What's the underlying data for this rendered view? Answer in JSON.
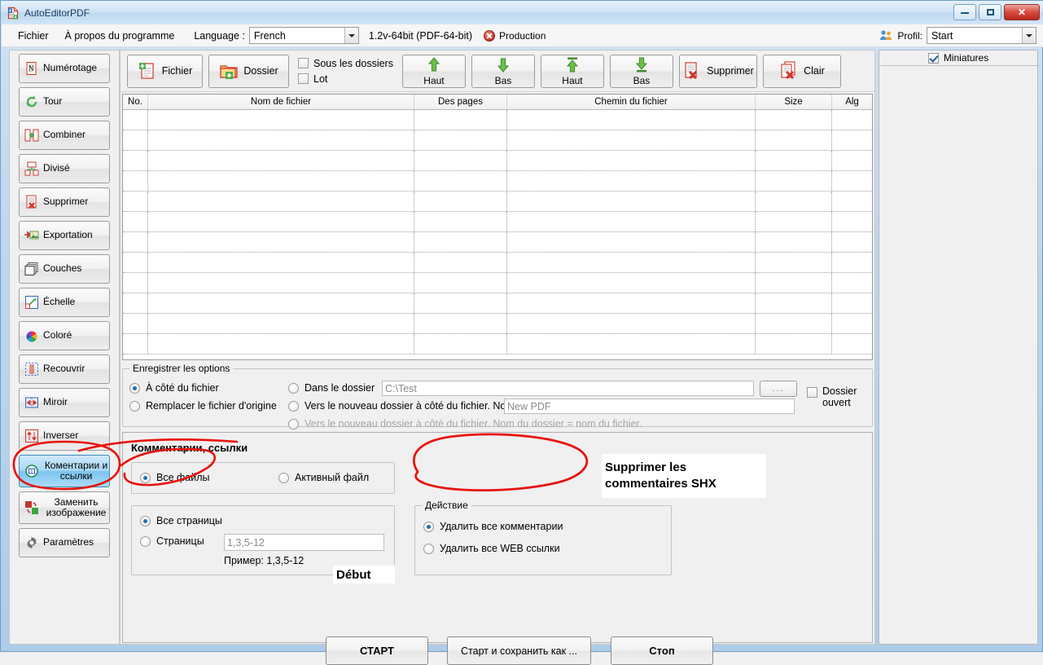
{
  "window": {
    "title": "AutoEditorPDF",
    "icon": "pdf-document-icon",
    "minimize": "minimize-icon",
    "maximize": "maximize-icon",
    "close": "✕"
  },
  "menu": {
    "file": "Fichier",
    "about": "À propos du programme",
    "language_label": "Language :",
    "language_value": "French",
    "version": "1.2v-64bit (PDF-64-bit)",
    "status": "Production",
    "profile_label": "Profil:",
    "profile_value": "Start"
  },
  "sidebar": {
    "items": [
      {
        "label": "Numérotage",
        "icon": "numbering-icon",
        "selected": false
      },
      {
        "label": "Tour",
        "icon": "rotate-icon",
        "selected": false
      },
      {
        "label": "Combiner",
        "icon": "merge-icon",
        "selected": false
      },
      {
        "label": "Divisé",
        "icon": "split-icon",
        "selected": false
      },
      {
        "label": "Supprimer",
        "icon": "delete-page-icon",
        "selected": false
      },
      {
        "label": "Exportation",
        "icon": "export-image-icon",
        "selected": false
      },
      {
        "label": "Couches",
        "icon": "layers-icon",
        "selected": false
      },
      {
        "label": "Échelle",
        "icon": "scale-icon",
        "selected": false
      },
      {
        "label": "Coloré",
        "icon": "color-wheel-icon",
        "selected": false
      },
      {
        "label": "Recouvrir",
        "icon": "crop-icon",
        "selected": false
      },
      {
        "label": "Miroir",
        "icon": "mirror-icon",
        "selected": false
      },
      {
        "label": "Inverser",
        "icon": "invert-icon",
        "selected": false
      },
      {
        "label": "Коментарии и ссылки",
        "icon": "comments-links-icon",
        "selected": true
      },
      {
        "label": "Заменить изображение",
        "icon": "replace-image-icon",
        "selected": false
      },
      {
        "label": "Paramètres",
        "icon": "gear-icon",
        "selected": false
      }
    ]
  },
  "toolbar": {
    "file_button": "Fichier",
    "folder_button": "Dossier",
    "subfolders_check": "Sous les dossiers",
    "subfolders_checked": false,
    "lot_check": "Lot",
    "lot_checked": false,
    "up1": "Haut",
    "down1": "Bas",
    "up2": "Haut",
    "down2": "Bas",
    "delete_button": "Supprimer",
    "clear_button": "Clair"
  },
  "filelist": {
    "columns": [
      "No.",
      "Nom de fichier",
      "Des pages",
      "Chemin du fichier",
      "Size",
      "Alg"
    ],
    "rows": []
  },
  "save_options": {
    "title": "Enregistrer les options",
    "opt_beside": "À côté du fichier",
    "opt_beside_selected": true,
    "opt_replace": "Remplacer le fichier d'origine",
    "opt_replace_selected": false,
    "opt_in_folder": "Dans le dossier",
    "opt_in_folder_selected": false,
    "folder_path_value": "C:\\Test",
    "browse_button": "...",
    "opt_new_folder": "Vers le nouveau dossier à côté du fichier. Nom de do",
    "opt_new_folder_selected": false,
    "new_folder_value": "New PDF",
    "opt_new_folder_same": "Vers le nouveau dossier à côté du fichier. Nom du dossier  = nom du fichier.",
    "opt_new_folder_same_selected": false,
    "open_folder_check": "Dossier ouvert",
    "open_folder_checked": false
  },
  "comments_panel": {
    "title": "Комментарии, ссылки",
    "scope": {
      "all_files": "Все файлы",
      "all_files_selected": true,
      "active_file": "Активный файл",
      "active_file_selected": false
    },
    "pages": {
      "all_pages": "Все страницы",
      "all_pages_selected": true,
      "pages": "Страницы",
      "pages_selected": false,
      "pages_input_placeholder": "1,3,5-12",
      "example": "Пример: 1,3,5-12"
    },
    "action": {
      "group_title": "Действие",
      "remove_comments": "Удалить все комментарии",
      "remove_comments_selected": true,
      "remove_weblinks": "Удалить все WEB ссылки",
      "remove_weblinks_selected": false
    }
  },
  "bottom_buttons": {
    "start": "СТАРТ",
    "start_save_as": "Старт и сохранить как ...",
    "stop": "Стоп"
  },
  "right_panel": {
    "thumbnails_label": "Miniatures",
    "thumbnails_checked": true
  },
  "annotations": {
    "color": "#e8120c",
    "label_shx": "Supprimer les\ncommentaires SHX",
    "label_debut": "Début"
  }
}
